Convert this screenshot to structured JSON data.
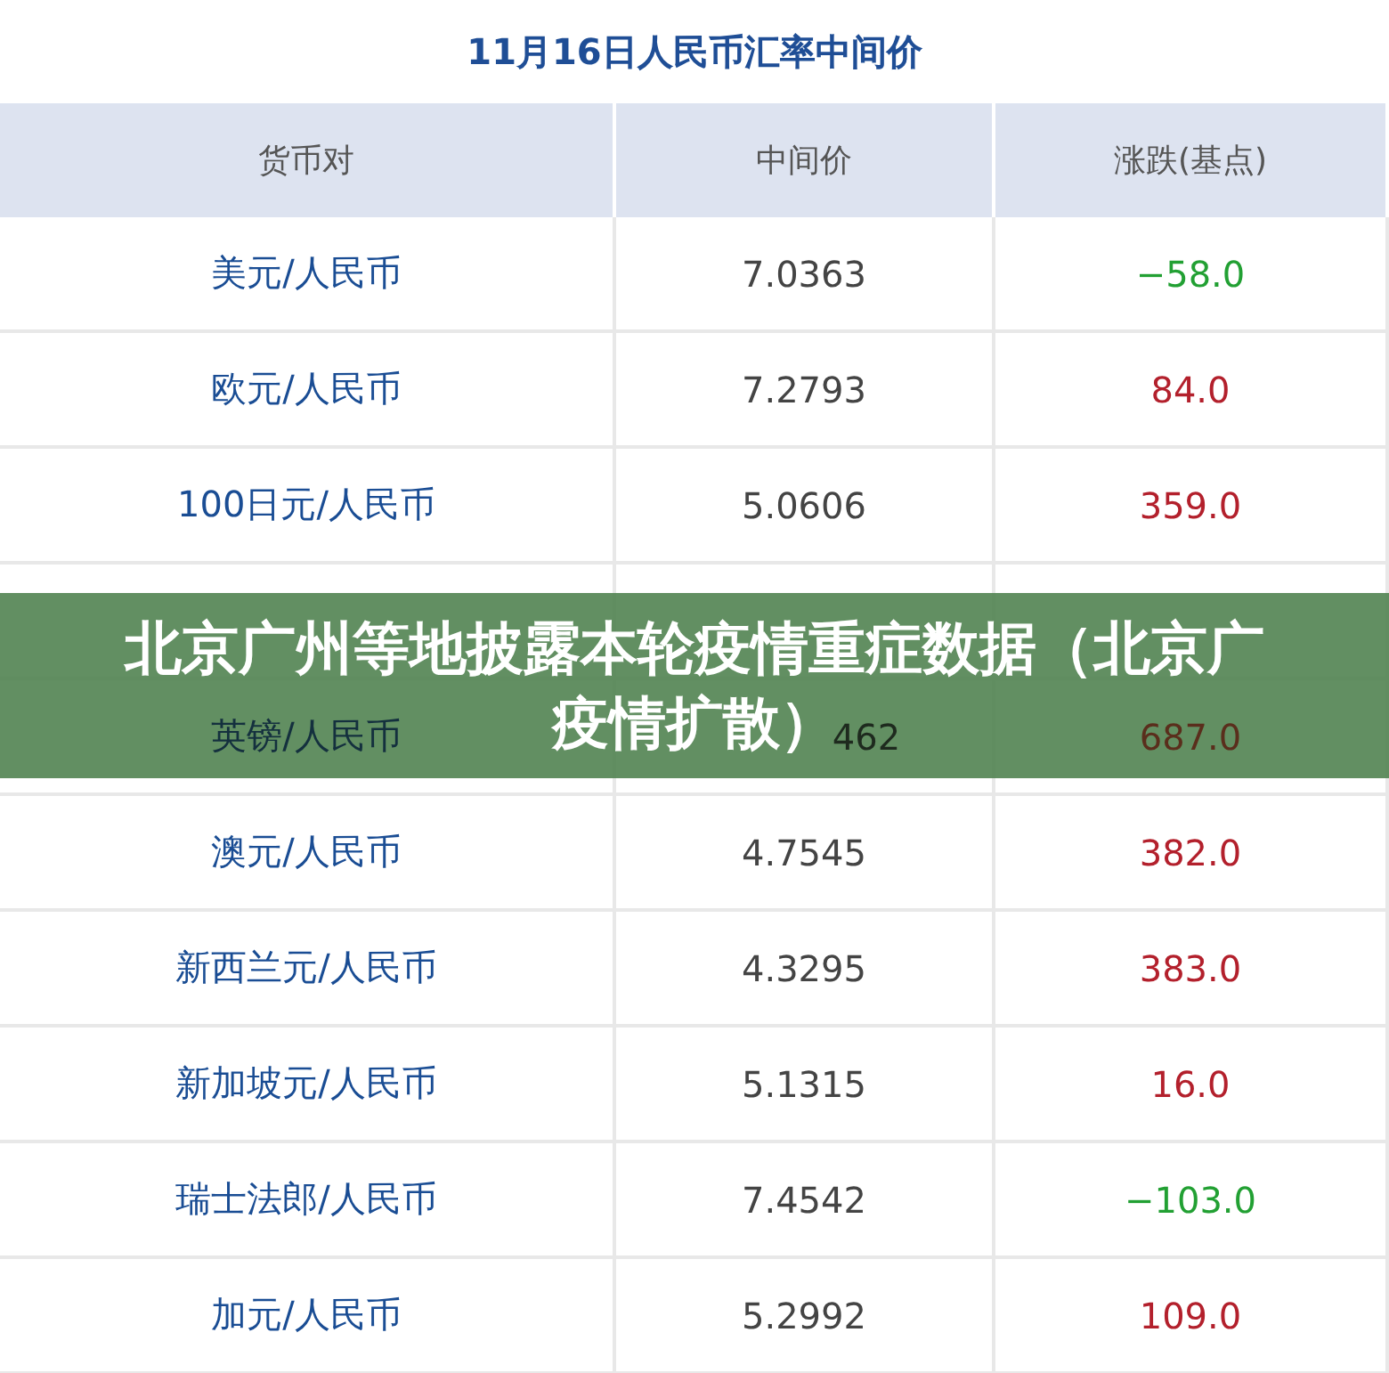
{
  "title": "11月16日人民币汇率中间价",
  "columns": [
    "货币对",
    "中间价",
    "涨跌(基点)"
  ],
  "rows": [
    {
      "kind": "plain",
      "pair": "美元/人民币",
      "mid": "7.0363",
      "change": "−58.0",
      "color": "#22a033"
    },
    {
      "kind": "plain",
      "pair": "欧元/人民币",
      "mid": "7.2793",
      "change": "84.0",
      "color": "#b3202c"
    },
    {
      "kind": "plain",
      "pair": "100日元/人民币",
      "mid": "5.0606",
      "change": "359.0",
      "color": "#b3202c"
    },
    {
      "kind": "hidden"
    },
    {
      "kind": "covered",
      "pair": "英镑/人民币",
      "mid": "462",
      "change": "687.0",
      "color": "#5a2e1c"
    },
    {
      "kind": "plain",
      "pair": "澳元/人民币",
      "mid": "4.7545",
      "change": "382.0",
      "color": "#b3202c"
    },
    {
      "kind": "plain",
      "pair": "新西兰元/人民币",
      "mid": "4.3295",
      "change": "383.0",
      "color": "#b3202c"
    },
    {
      "kind": "plain",
      "pair": "新加坡元/人民币",
      "mid": "5.1315",
      "change": "16.0",
      "color": "#b3202c"
    },
    {
      "kind": "plain",
      "pair": "瑞士法郎/人民币",
      "mid": "7.4542",
      "change": "−103.0",
      "color": "#22a033"
    },
    {
      "kind": "plain",
      "pair": "加元/人民币",
      "mid": "5.2992",
      "change": "109.0",
      "color": "#b3202c"
    }
  ],
  "banner_lines": [
    "北京广州等地披露本轮疫情重症数据（北京广",
    "疫情扩散）"
  ]
}
